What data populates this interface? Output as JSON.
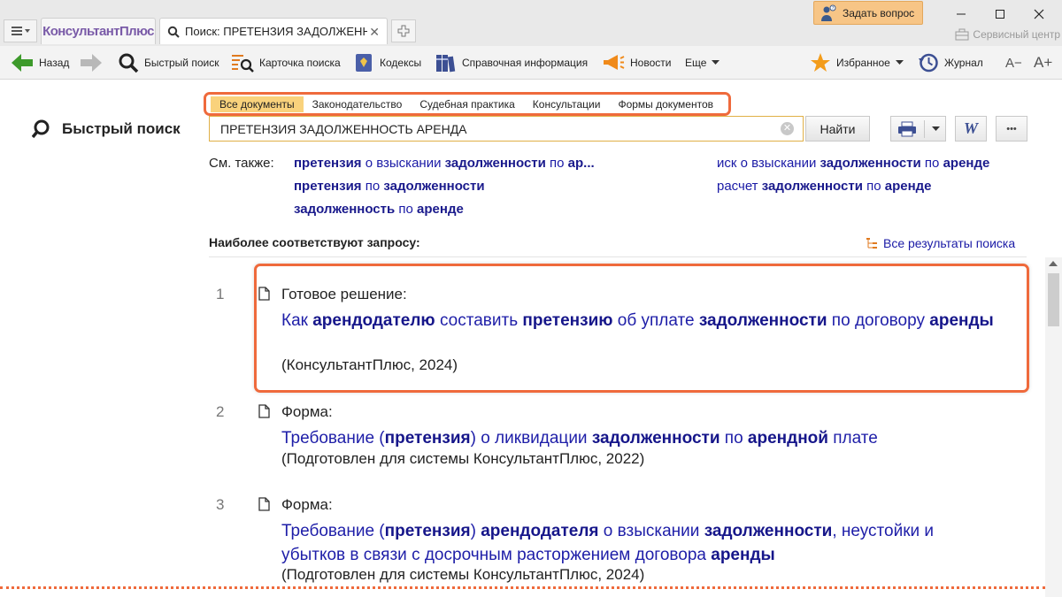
{
  "window": {
    "brand_tab": "КонсультантПлюс",
    "active_tab": "Поиск: ПРЕТЕНЗИЯ ЗАДОЛЖЕННОСТЬ АРЕНДА",
    "ask_button": "Задать вопрос",
    "service_center": "Сервисный центр"
  },
  "toolbar": {
    "back": "Назад",
    "quick_search": "Быстрый поиск",
    "search_card": "Карточка поиска",
    "codes": "Кодексы",
    "reference": "Справочная информация",
    "news": "Новости",
    "more": "Еще",
    "favorites": "Избранное",
    "journal": "Журнал",
    "font_smaller": "A−",
    "font_larger": "A+"
  },
  "panel": {
    "title": "Быстрый поиск"
  },
  "search": {
    "tabs": [
      "Все документы",
      "Законодательство",
      "Судебная практика",
      "Консультации",
      "Формы документов"
    ],
    "query": "ПРЕТЕНЗИЯ ЗАДОЛЖЕННОСТЬ АРЕНДА",
    "find_button": "Найти",
    "word_button": "W",
    "more_button": "•••"
  },
  "see_also": {
    "label": "См. также:",
    "left": [
      [
        {
          "t": "претензия",
          "b": true
        },
        {
          "t": " о взыскании ",
          "b": false
        },
        {
          "t": "задолженности",
          "b": true
        },
        {
          "t": " по ",
          "b": false
        },
        {
          "t": "ар...",
          "b": true
        }
      ],
      [
        {
          "t": "претензия",
          "b": true
        },
        {
          "t": " по ",
          "b": false
        },
        {
          "t": "задолженности",
          "b": true
        }
      ],
      [
        {
          "t": "задолженность",
          "b": true
        },
        {
          "t": " по ",
          "b": false
        },
        {
          "t": "аренде",
          "b": true
        }
      ]
    ],
    "right": [
      [
        {
          "t": "иск о взыскании ",
          "b": false
        },
        {
          "t": "задолженности",
          "b": true
        },
        {
          "t": " по ",
          "b": false
        },
        {
          "t": "аренде",
          "b": true
        }
      ],
      [
        {
          "t": "расчет ",
          "b": false
        },
        {
          "t": "задолженности",
          "b": true
        },
        {
          "t": " по ",
          "b": false
        },
        {
          "t": "аренде",
          "b": true
        }
      ]
    ]
  },
  "results_header": {
    "title": "Наиболее соответствуют запросу:",
    "all_results": "Все результаты поиска"
  },
  "results": [
    {
      "num": "1",
      "type": "Готовое решение:",
      "title": [
        {
          "t": "Как ",
          "b": false
        },
        {
          "t": "арендодателю",
          "b": true
        },
        {
          "t": " составить ",
          "b": false
        },
        {
          "t": "претензию",
          "b": true
        },
        {
          "t": " об уплате ",
          "b": false
        },
        {
          "t": "задолженности",
          "b": true
        },
        {
          "t": " по договору ",
          "b": false
        },
        {
          "t": "аренды",
          "b": true
        }
      ],
      "source": "(КонсультантПлюс, 2024)"
    },
    {
      "num": "2",
      "type": "Форма:",
      "title": [
        {
          "t": "Требование (",
          "b": false
        },
        {
          "t": "претензия",
          "b": true
        },
        {
          "t": ") о ликвидации ",
          "b": false
        },
        {
          "t": "задолженности",
          "b": true
        },
        {
          "t": " по ",
          "b": false
        },
        {
          "t": "арендной",
          "b": true
        },
        {
          "t": " плате",
          "b": false
        }
      ],
      "source": "(Подготовлен для системы КонсультантПлюс, 2022)"
    },
    {
      "num": "3",
      "type": "Форма:",
      "title": [
        {
          "t": "Требование (",
          "b": false
        },
        {
          "t": "претензия",
          "b": true
        },
        {
          "t": ") ",
          "b": false
        },
        {
          "t": "арендодателя",
          "b": true
        },
        {
          "t": " о взыскании ",
          "b": false
        },
        {
          "t": "задолженности",
          "b": true
        },
        {
          "t": ", неустойки и убытков в связи с досрочным расторжением договора ",
          "b": false
        },
        {
          "t": "аренды",
          "b": true
        }
      ],
      "source": "(Подготовлен для системы КонсультантПлюс, 2024)"
    }
  ],
  "colors": {
    "accent_orange": "#ef6a3c",
    "link_blue": "#1e1ea8",
    "active_tab": "#f9d27c"
  }
}
